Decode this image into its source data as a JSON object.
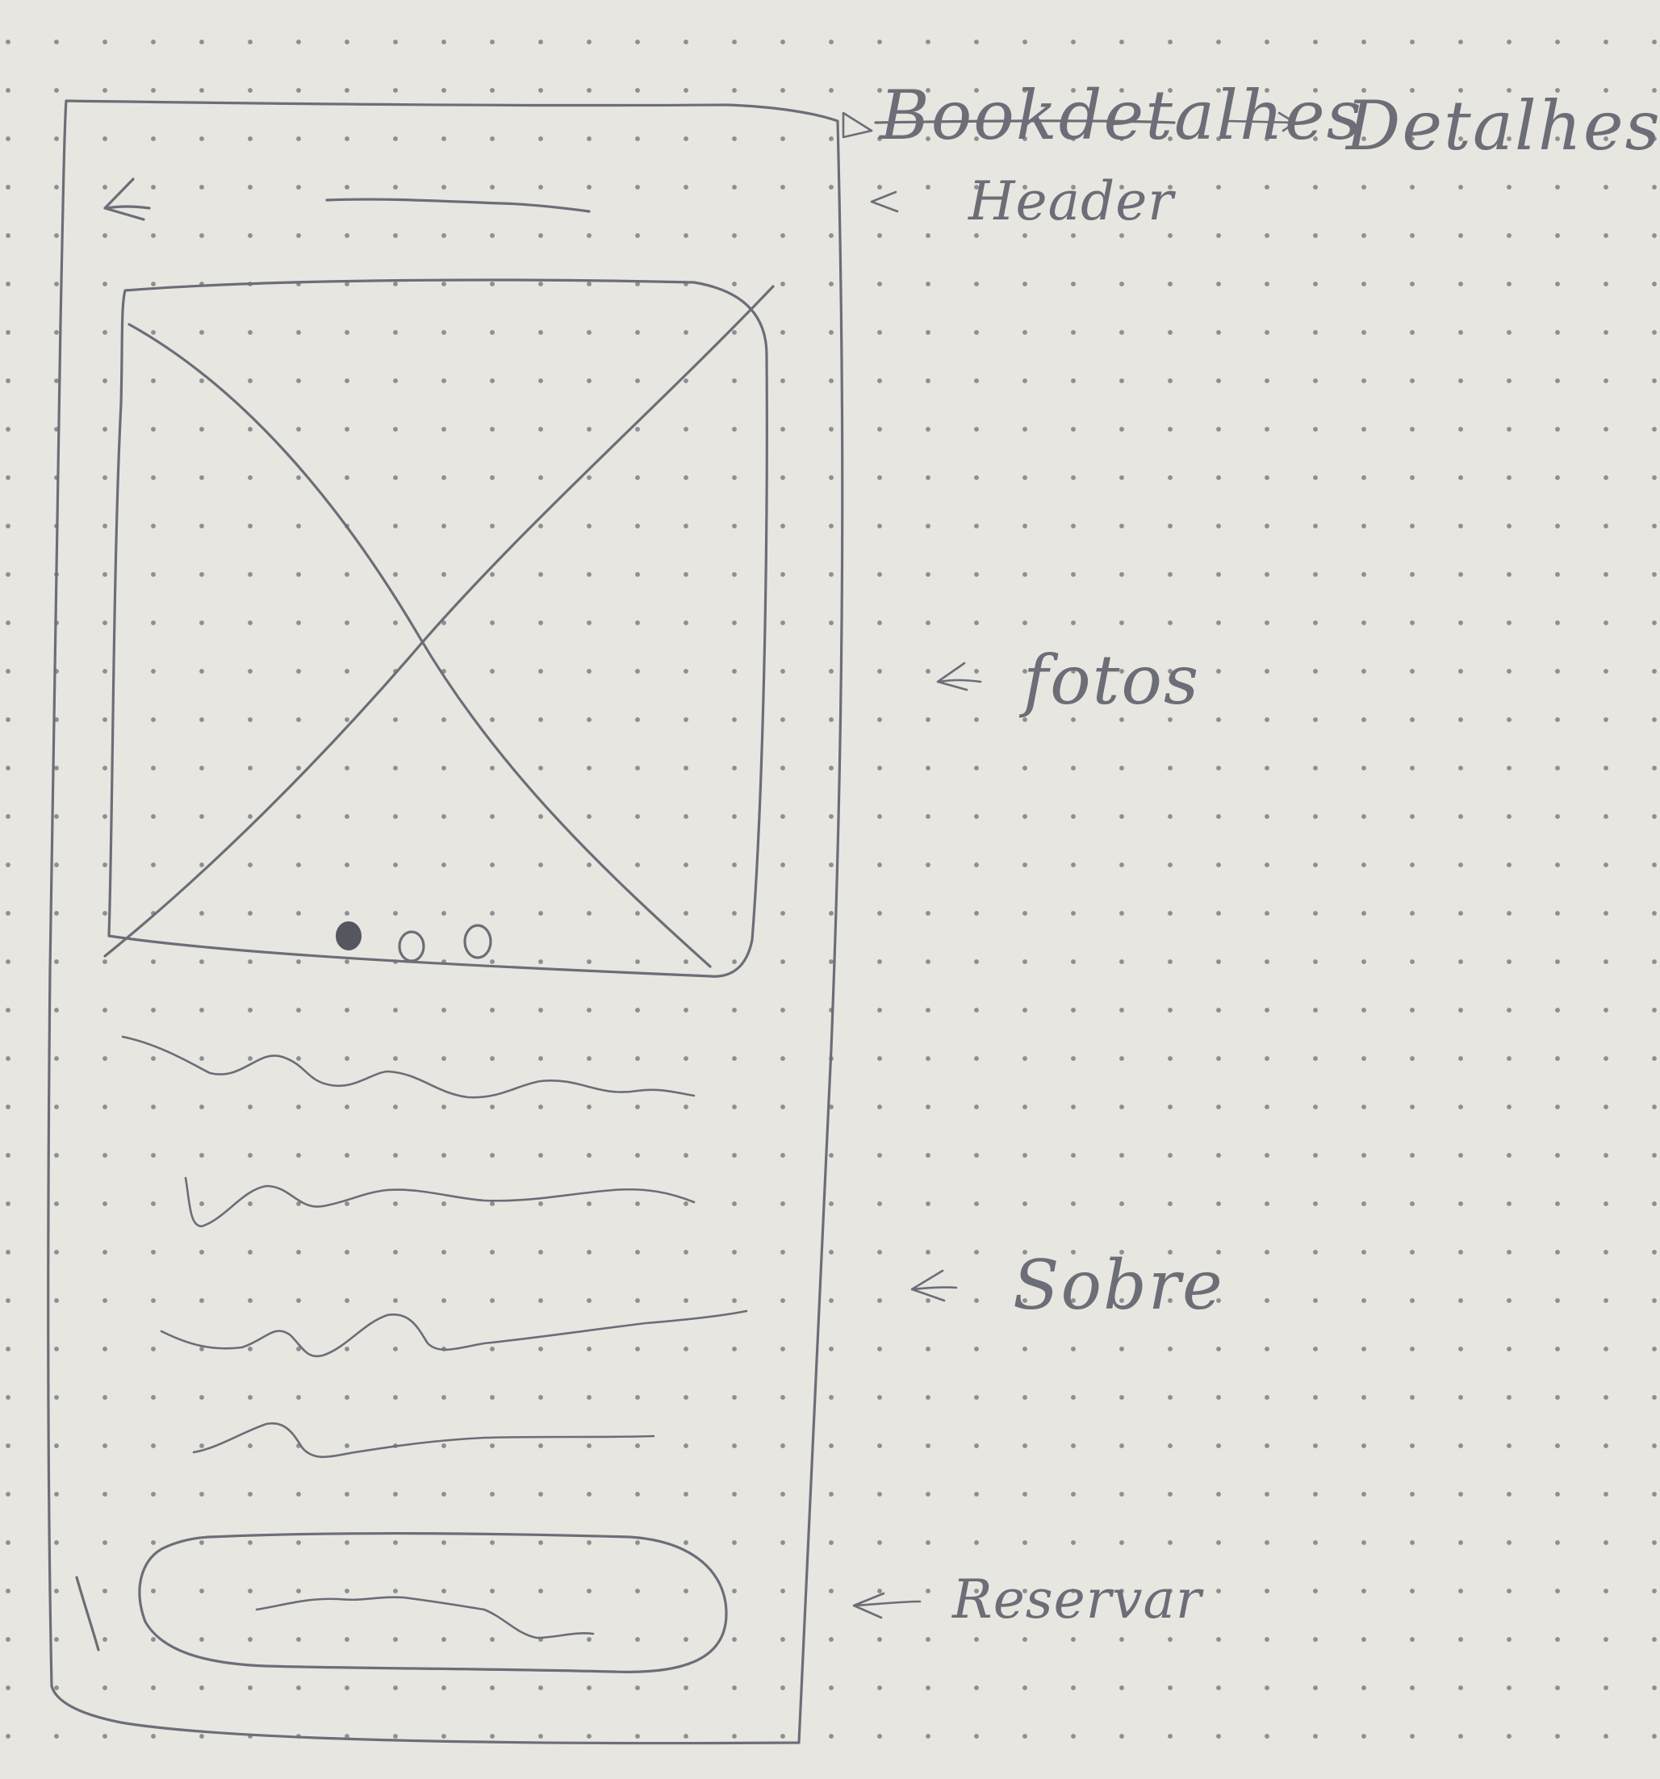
{
  "annotations": {
    "title_struck": "Bookdetalhes",
    "title": "Detalhes",
    "header": "Header",
    "photos": "fotos",
    "about": "Sobre",
    "reserve": "Reservar"
  },
  "carousel": {
    "page_count": 3,
    "active_index": 0
  },
  "colors": {
    "paper": "#e7e6e0",
    "pencil": "#6c6d77",
    "grid_dot": "#8f8f92"
  }
}
